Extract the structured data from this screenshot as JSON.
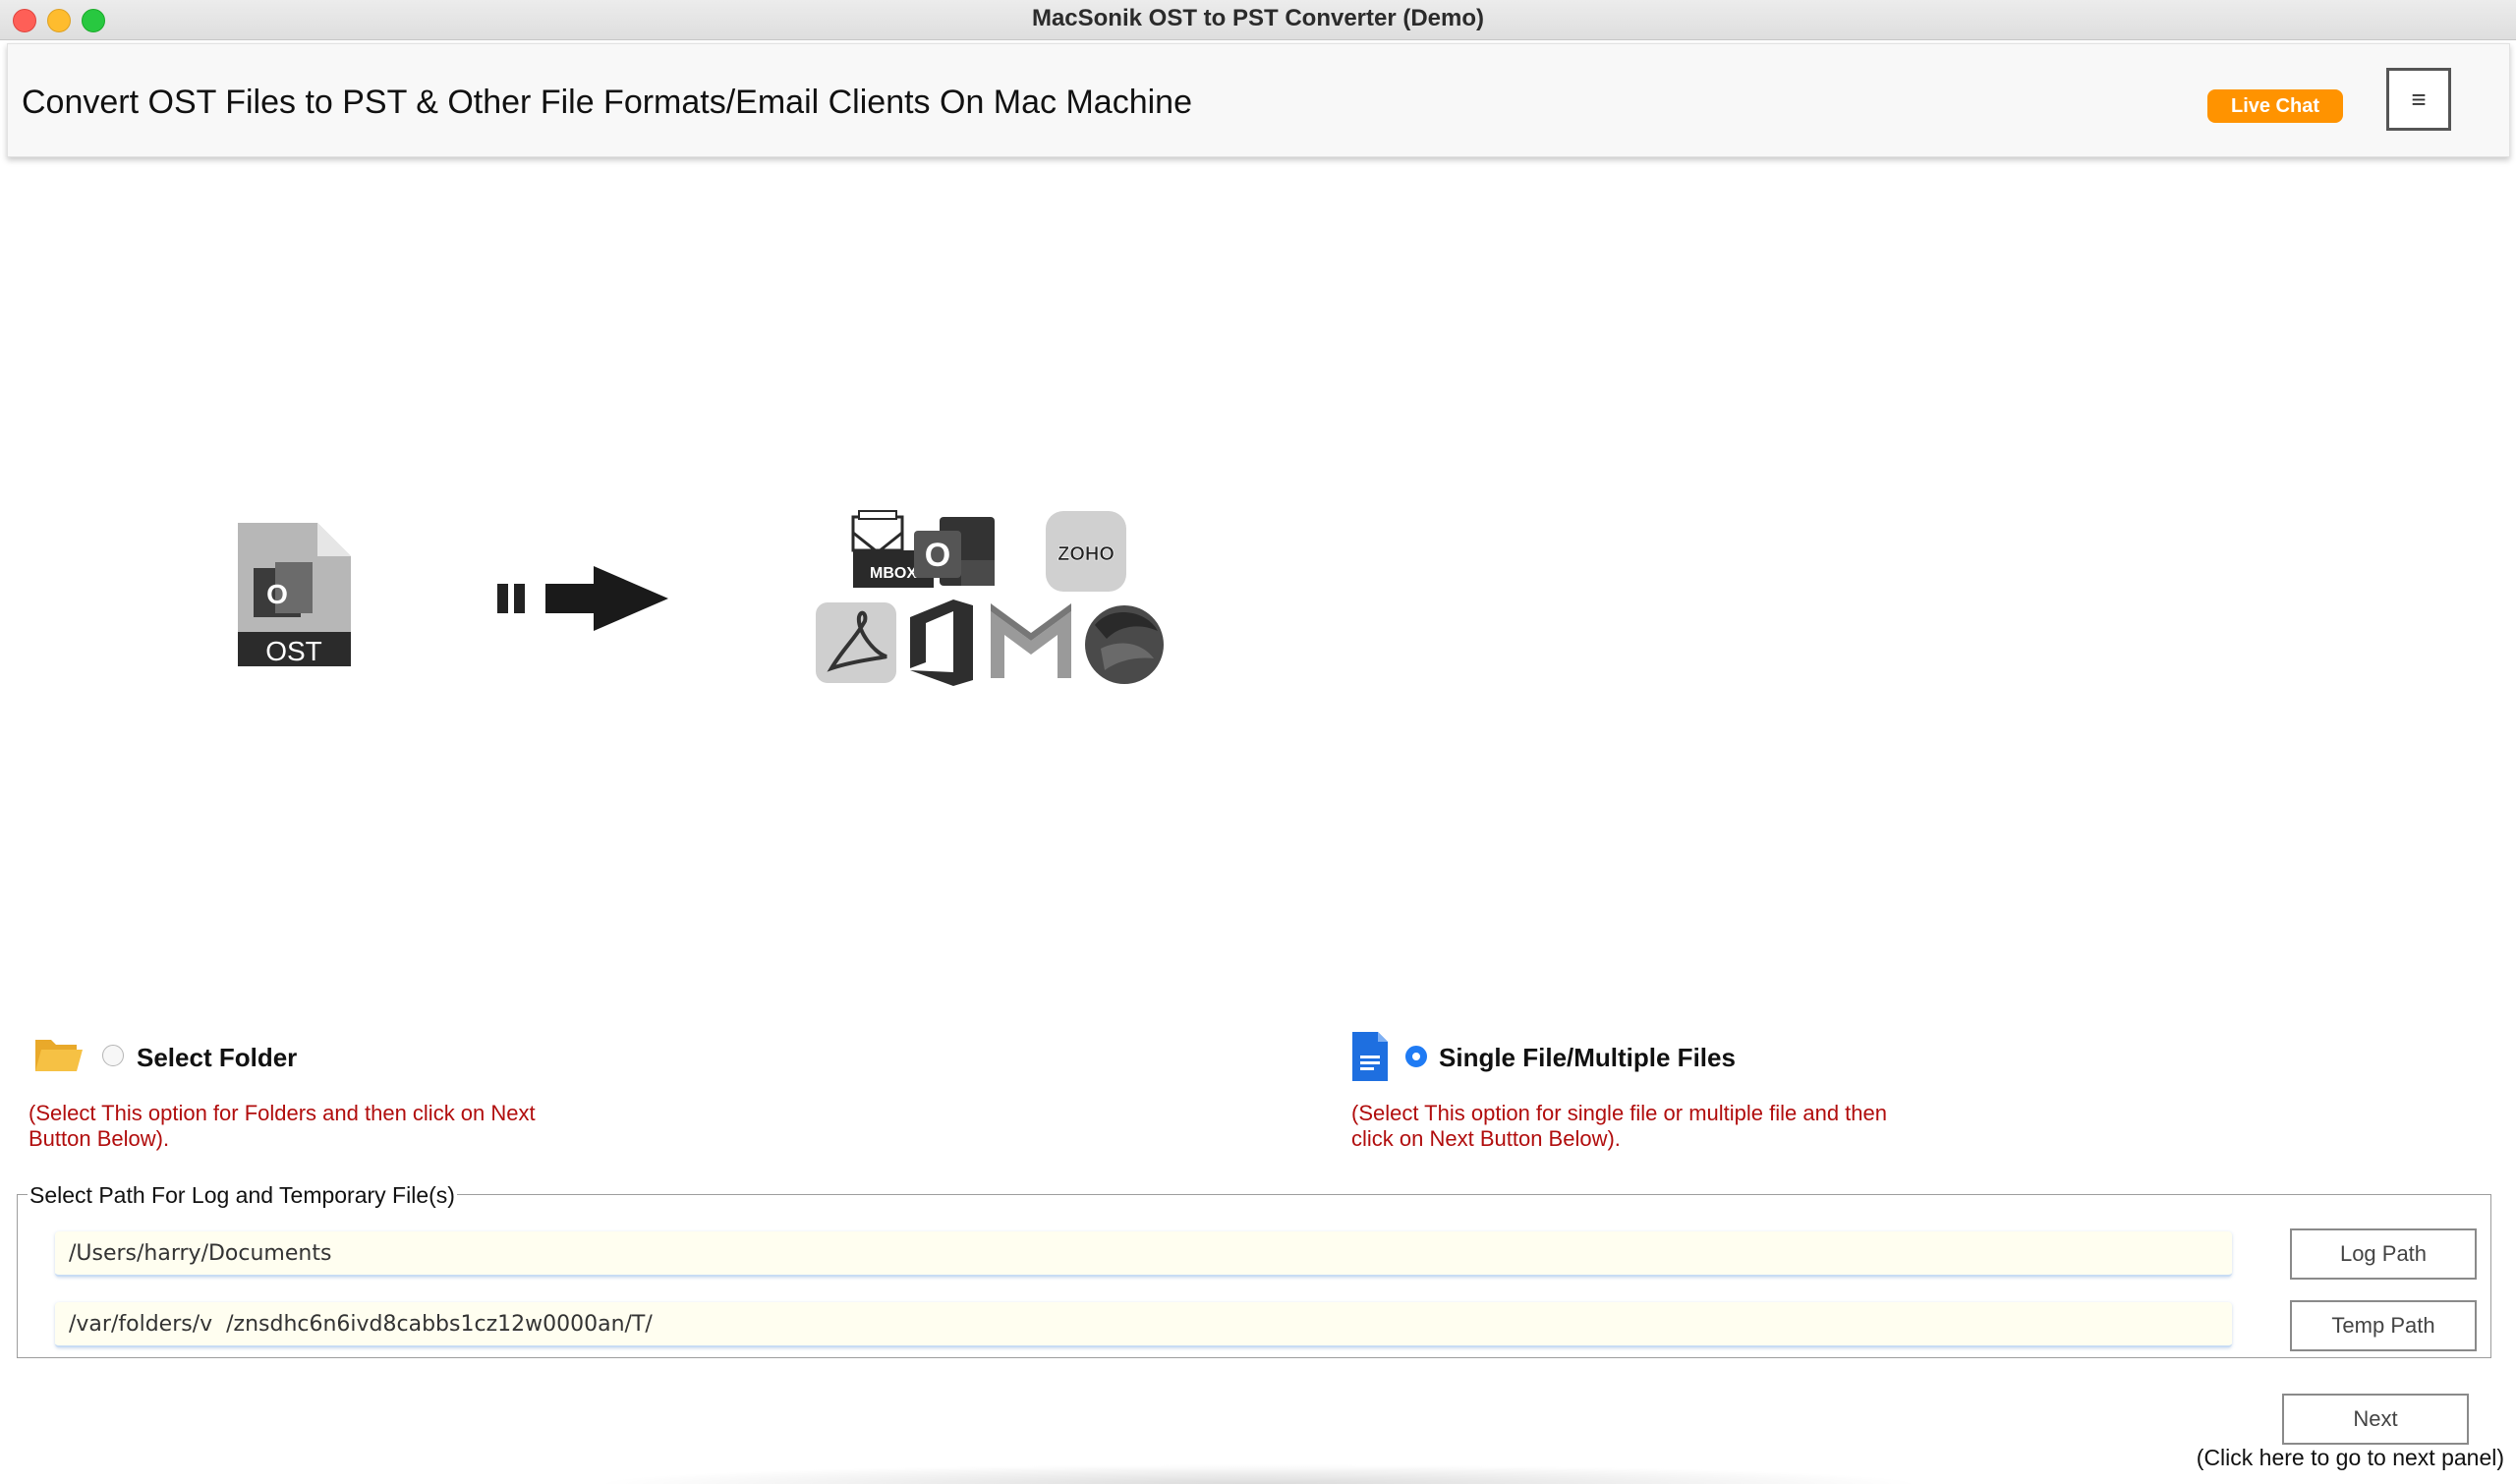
{
  "window": {
    "title": "MacSonik OST to PST Converter (Demo)"
  },
  "header": {
    "title": "Convert OST Files to PST & Other File Formats/Email Clients On Mac Machine",
    "live_chat_label": "Live Chat",
    "menu_glyph": "≡"
  },
  "graphic": {
    "source_label": "OST",
    "mbox_label": "MBOX",
    "zoho_label": "ZOHO",
    "outlook_letter": "O",
    "icons": [
      "ost-file-icon",
      "arrow-right-icon",
      "mbox-icon",
      "outlook-icon",
      "zoho-icon",
      "pdf-icon",
      "office-icon",
      "gmail-icon",
      "thunderbird-icon"
    ]
  },
  "options": {
    "folder": {
      "label": "Select Folder",
      "help_line1": "(Select This option for Folders and then click on Next",
      "help_line2": "Button Below).",
      "selected": false,
      "icon": "folder-icon"
    },
    "files": {
      "label": "Single File/Multiple Files",
      "help_line1": "(Select This option for single file or multiple file and then",
      "help_line2": "click on Next Button Below).",
      "selected": true,
      "icon": "document-icon"
    }
  },
  "paths": {
    "legend": "Select Path For Log and Temporary File(s)",
    "log_path_value": "/Users/harry/Documents",
    "log_path_button": "Log Path",
    "temp_path_value": "/var/folders/v  /znsdhc6n6ivd8cabbs1cz12w0000an/T/",
    "temp_path_button": "Temp Path"
  },
  "footer": {
    "next_label": "Next",
    "next_hint": "(Click here to go to next panel)"
  },
  "colors": {
    "accent_orange": "#ff9300",
    "help_red": "#b10d0d",
    "radio_blue": "#1f7bf4"
  }
}
